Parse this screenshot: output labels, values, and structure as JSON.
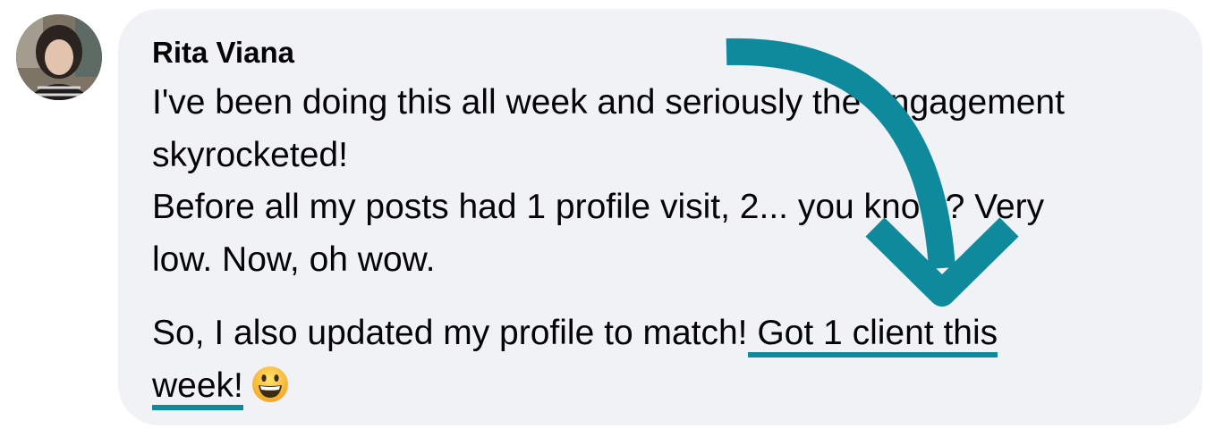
{
  "comment": {
    "author": "Rita Viana",
    "paragraph1": {
      "line1": "I've been doing this all week and seriously the engagement",
      "line2": "skyrocketed!",
      "line3": "Before all my posts had 1 profile visit, 2... you know? Very",
      "line4": "low. Now, oh wow."
    },
    "paragraph2": {
      "line1_plain": "So, I also updated my profile to match!",
      "line1_highlight": " Got 1 client this",
      "line2_highlight": "week!",
      "emoji_name": "grinning-face-emoji"
    }
  },
  "annotation": {
    "arrow_color": "#0f8a9d",
    "underline_color": "#0f8a9d"
  }
}
